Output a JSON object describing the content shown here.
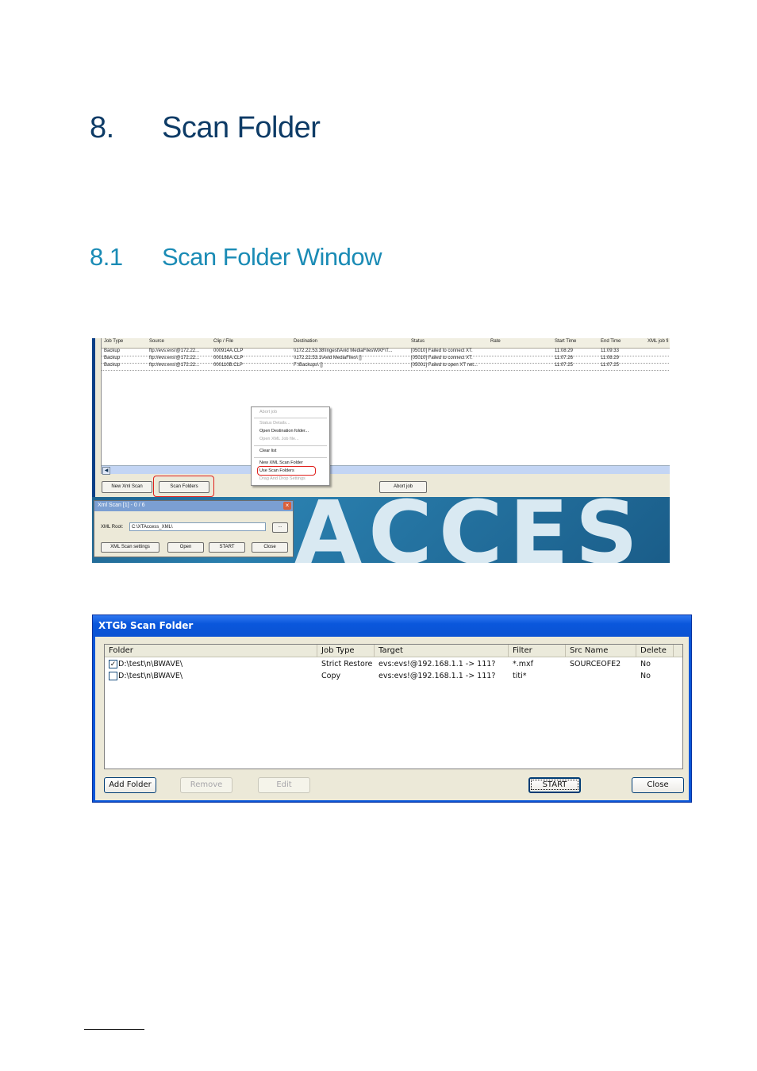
{
  "section": {
    "number": "8.",
    "title": "Scan Folder"
  },
  "subsection": {
    "number": "8.1",
    "title": "Scan Folder Window"
  },
  "screenshot1": {
    "columns": [
      "Job Type",
      "Source",
      "Clip / File",
      "Destination",
      "Status",
      "Rate",
      "Start Time",
      "End Time",
      "XML job fi"
    ],
    "rows": [
      [
        "Backup",
        "ftp://evs:evs!@172.22...",
        "000914A.CLP",
        "\\\\172.22.53.38\\Ingest\\Avid MediaFiles\\MXF\\T...",
        "[05010] Failed to connect XT.",
        "",
        "11:08:29",
        "11:09:33",
        ""
      ],
      [
        "Backup",
        "ftp://evs:evs!@172.22...",
        "000188A.CLP",
        "\\\\172.22.53.1\\Avid MediaFiles\\ []",
        "[05010] Failed to connect XT.",
        "",
        "11:07:26",
        "11:08:29",
        ""
      ],
      [
        "Backup",
        "ftp://evs:evs!@172.22...",
        "000110B.CLP",
        "F:\\Backups\\ []",
        "[05001] Failed to open XT net...",
        "",
        "11:07:25",
        "11:07:25",
        ""
      ]
    ],
    "buttons": {
      "new_xml_scan": "New Xml Scan",
      "scan_folders": "Scan Folders",
      "abort_job": "Abort job"
    },
    "context_menu": {
      "abort_job": "Abort job",
      "status_details": "Status Details...",
      "open_destination": "Open Destination folder...",
      "open_xml_job": "Open XML Job file...",
      "clear_list": "Clear list",
      "new_xml_scan_folder": "New XML Scan Folder",
      "use_scan_folders": "Use Scan Folders",
      "drag_drop_settings": "Drag And Drop Settings"
    },
    "xml_scan": {
      "title": "Xml Scan [1] - 0 / 6",
      "xml_root_label": "XML Root:",
      "xml_root_value": "C:\\XTAccess_XML\\",
      "browse": "...",
      "settings": "XML Scan settings",
      "open": "Open",
      "start": "START",
      "close": "Close"
    },
    "background_text": "ACCES"
  },
  "screenshot2": {
    "title": "XTGb Scan Folder",
    "columns": [
      "Folder",
      "Job Type",
      "Target",
      "Filter",
      "Src Name",
      "Delete"
    ],
    "rows": [
      {
        "checked": true,
        "check_mark": "✓",
        "folder": "D:\\test\\n\\BWAVE\\",
        "job_type": "Strict Restore",
        "target": "evs:evs!@192.168.1.1 -> 111?",
        "filter": "*.mxf",
        "src_name": "SOURCEOFE2",
        "delete": "No"
      },
      {
        "checked": false,
        "check_mark": "",
        "folder": "D:\\test\\n\\BWAVE\\",
        "job_type": "Copy",
        "target": "evs:evs!@192.168.1.1 -> 111?",
        "filter": "titi*",
        "src_name": "",
        "delete": "No"
      }
    ],
    "buttons": {
      "add_folder": "Add Folder",
      "remove": "Remove",
      "edit": "Edit",
      "start": "START",
      "close": "Close"
    }
  }
}
